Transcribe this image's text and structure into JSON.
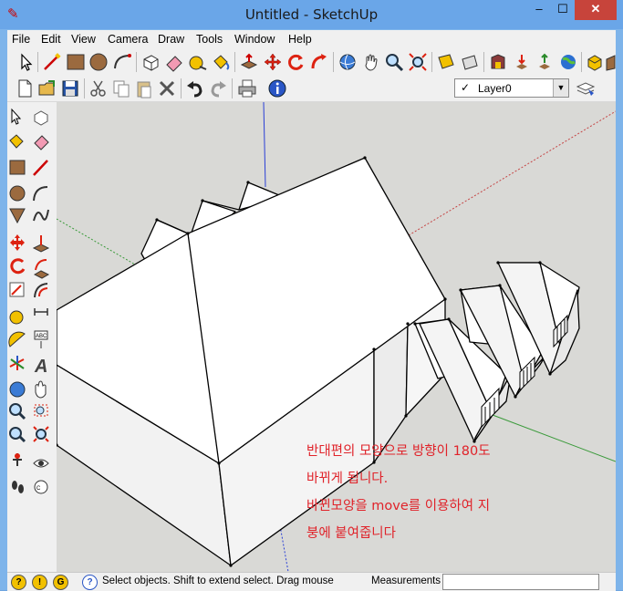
{
  "window": {
    "title": "Untitled - SketchUp",
    "app_icon": "sketchup-pencil-icon"
  },
  "title_buttons": {
    "minimize": "–",
    "maximize": "☐",
    "close": "✕"
  },
  "menu": [
    "File",
    "Edit",
    "View",
    "Camera",
    "Draw",
    "Tools",
    "Window",
    "Help"
  ],
  "toolbar": {
    "large_tools": [
      "select",
      "line",
      "rectangle",
      "circle",
      "arc",
      "make-component",
      "eraser",
      "tape-measure",
      "paint-bucket",
      "push-pull",
      "move",
      "rotate",
      "follow-me",
      "orbit",
      "pan",
      "zoom",
      "zoom-extents",
      "section-plane",
      "warehouse",
      "get-models",
      "share-model",
      "google-earth",
      "components",
      "materials"
    ],
    "standard_tools": [
      "new",
      "open",
      "save",
      "cut",
      "copy",
      "paste",
      "delete",
      "undo",
      "redo",
      "print",
      "model-info"
    ],
    "layer": {
      "check": "✓",
      "name": "Layer0",
      "arrow": "▼"
    }
  },
  "left_toolbar": [
    "select",
    "make-component",
    "paint-bucket",
    "eraser",
    "rectangle",
    "line",
    "circle",
    "arc",
    "polygon",
    "freehand",
    "move",
    "push-pull",
    "rotate",
    "follow-me",
    "scale",
    "offset",
    "tape-measure",
    "dimension",
    "protractor",
    "text",
    "axes",
    "3d-text",
    "orbit",
    "pan",
    "zoom",
    "zoom-window",
    "previous",
    "zoom-extents",
    "position-camera",
    "look-around",
    "walk",
    "section-plane"
  ],
  "annotation": {
    "line1": "반대편의 모양으로 방향이 180도",
    "line2": "바뀌게 됩니다.",
    "line3": "바뀐모양을 move를 이용하여 지",
    "line4": "붕에 붙여줍니다"
  },
  "status": {
    "hint": "Select objects. Shift to extend select. Drag mouse",
    "measurements_label": "Measurements",
    "measurements_value": ""
  },
  "colors": {
    "accent_red": "#e0232a",
    "viewport_bg": "#d9d9d6",
    "face": "#ffffff"
  }
}
